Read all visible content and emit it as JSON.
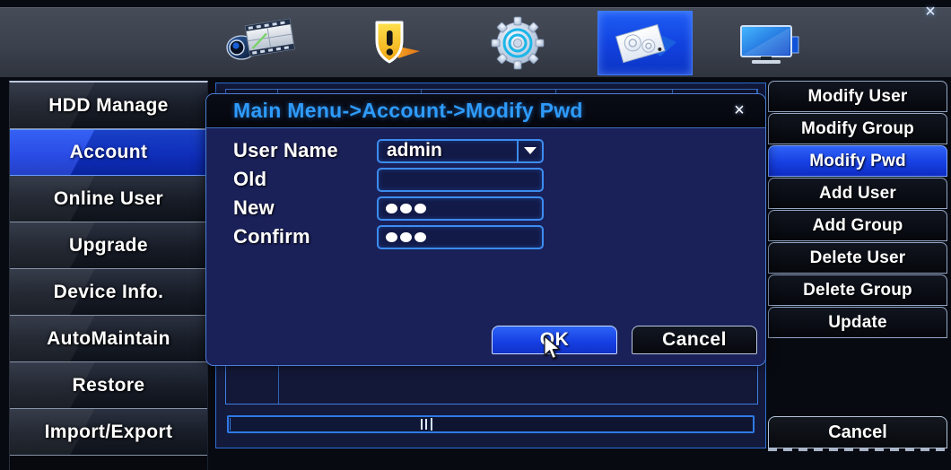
{
  "window": {
    "close_label": "×"
  },
  "toolbar": {
    "items": [
      {
        "name": "record-icon",
        "label": "Record"
      },
      {
        "name": "alarm-icon",
        "label": "Alarm"
      },
      {
        "name": "system-icon",
        "label": "System"
      },
      {
        "name": "advanced-icon",
        "label": "Advanced",
        "active": true
      },
      {
        "name": "display-icon",
        "label": "Display"
      }
    ],
    "active_index": 3
  },
  "left_menu": {
    "items": [
      {
        "label": "HDD Manage",
        "active": false
      },
      {
        "label": "Account",
        "active": true
      },
      {
        "label": "Online User",
        "active": false
      },
      {
        "label": "Upgrade",
        "active": false
      },
      {
        "label": "Device Info.",
        "active": false
      },
      {
        "label": "AutoMaintain",
        "active": false
      },
      {
        "label": "Restore",
        "active": false
      },
      {
        "label": "Import/Export",
        "active": false
      }
    ]
  },
  "right_menu": {
    "items": [
      {
        "label": "Modify User",
        "active": false
      },
      {
        "label": "Modify Group",
        "active": false
      },
      {
        "label": "Modify Pwd",
        "active": true
      },
      {
        "label": "Add User",
        "active": false
      },
      {
        "label": "Add Group",
        "active": false
      },
      {
        "label": "Delete User",
        "active": false
      },
      {
        "label": "Delete Group",
        "active": false
      },
      {
        "label": "Update",
        "active": false
      }
    ],
    "cancel_label": "Cancel"
  },
  "dialog": {
    "title": "Main Menu->Account->Modify Pwd",
    "close_label": "×",
    "fields": [
      {
        "label": "User Name",
        "type": "select",
        "value": "admin",
        "dots": 0
      },
      {
        "label": "Old",
        "type": "password",
        "value": "",
        "dots": 0
      },
      {
        "label": "New",
        "type": "password",
        "value": "",
        "dots": 3
      },
      {
        "label": "Confirm",
        "type": "password",
        "value": "",
        "dots": 3
      }
    ],
    "ok_label": "OK",
    "cancel_label": "Cancel"
  },
  "colors": {
    "accent_blue": "#1741e4",
    "title_text": "#2e9bfb",
    "field_border": "#3c8cf0",
    "dialog_bg": "#1a2058",
    "toolbar_bg": "#3b414d"
  }
}
